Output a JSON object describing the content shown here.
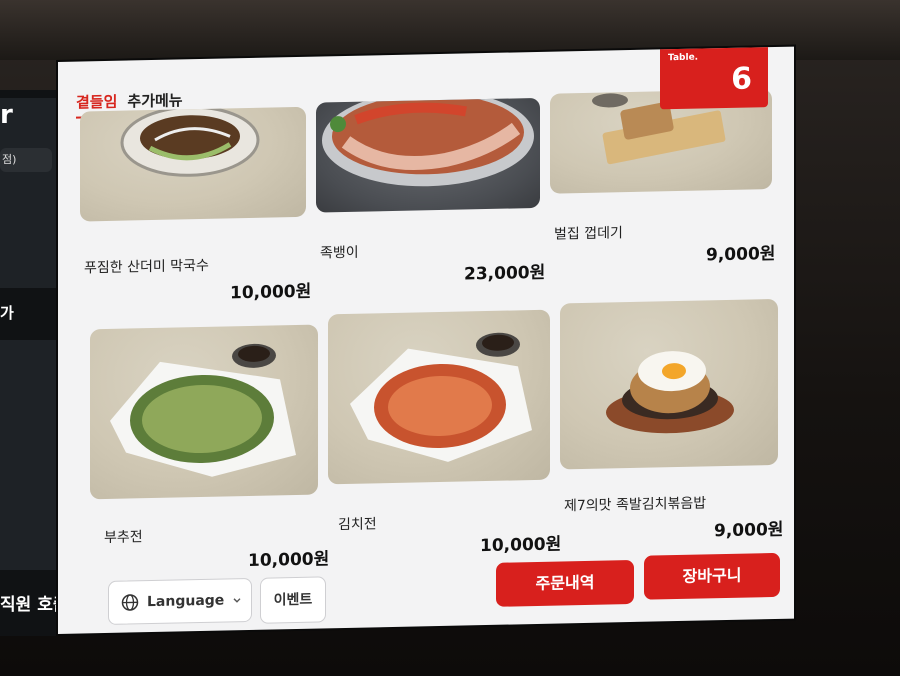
{
  "table": {
    "label": "Table.",
    "number": "6"
  },
  "tabs": [
    {
      "label": "곁들임",
      "active": true
    },
    {
      "label": "추가메뉴",
      "active": false
    }
  ],
  "left_panel": {
    "brand_partial": "r",
    "pill_partial": "점)",
    "section_partial": "가",
    "call_staff": "직원 호출"
  },
  "menu_items": [
    {
      "name": "푸짐한 산더미 막국수",
      "price": "10,000원"
    },
    {
      "name": "족뱅이",
      "price": "23,000원"
    },
    {
      "name": "벌집 껍데기",
      "price": "9,000원"
    },
    {
      "name": "부추전",
      "price": "10,000원"
    },
    {
      "name": "김치전",
      "price": "10,000원"
    },
    {
      "name": "제7의맛 족발김치볶음밥",
      "price": "9,000원"
    }
  ],
  "bottom": {
    "language": "Language",
    "event": "이벤트",
    "order_history": "주문내역",
    "cart": "장바구니"
  },
  "colors": {
    "accent": "#d8201d",
    "screen_bg": "#f3f3f4"
  }
}
